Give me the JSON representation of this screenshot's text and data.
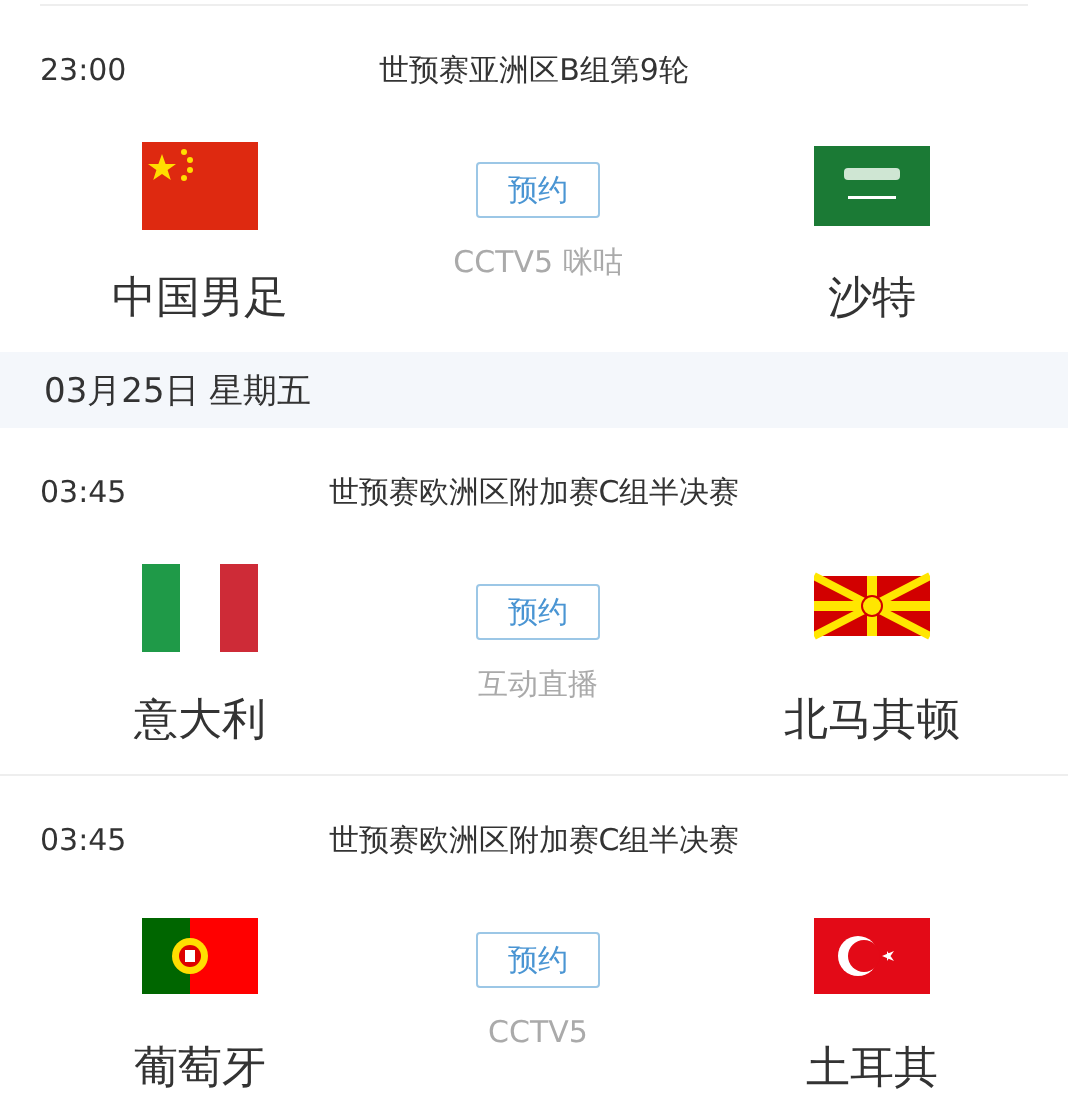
{
  "sections": [
    {
      "matches": [
        {
          "time": "23:00",
          "title": "世预赛亚洲区B组第9轮",
          "home": {
            "name": "中国男足",
            "kind": "china"
          },
          "away": {
            "name": "沙特",
            "kind": "saudi"
          },
          "button": "预约",
          "channel": "CCTV5 咪咕"
        }
      ]
    },
    {
      "date_header": "03月25日 星期五",
      "matches": [
        {
          "time": "03:45",
          "title": "世预赛欧洲区附加赛C组半决赛",
          "home": {
            "name": "意大利",
            "kind": "italy"
          },
          "away": {
            "name": "北马其顿",
            "kind": "macedonia"
          },
          "button": "预约",
          "channel": "互动直播"
        },
        {
          "time": "03:45",
          "title": "世预赛欧洲区附加赛C组半决赛",
          "home": {
            "name": "葡萄牙",
            "kind": "portugal"
          },
          "away": {
            "name": "土耳其",
            "kind": "turkey"
          },
          "button": "预约",
          "channel": "CCTV5"
        }
      ]
    }
  ]
}
